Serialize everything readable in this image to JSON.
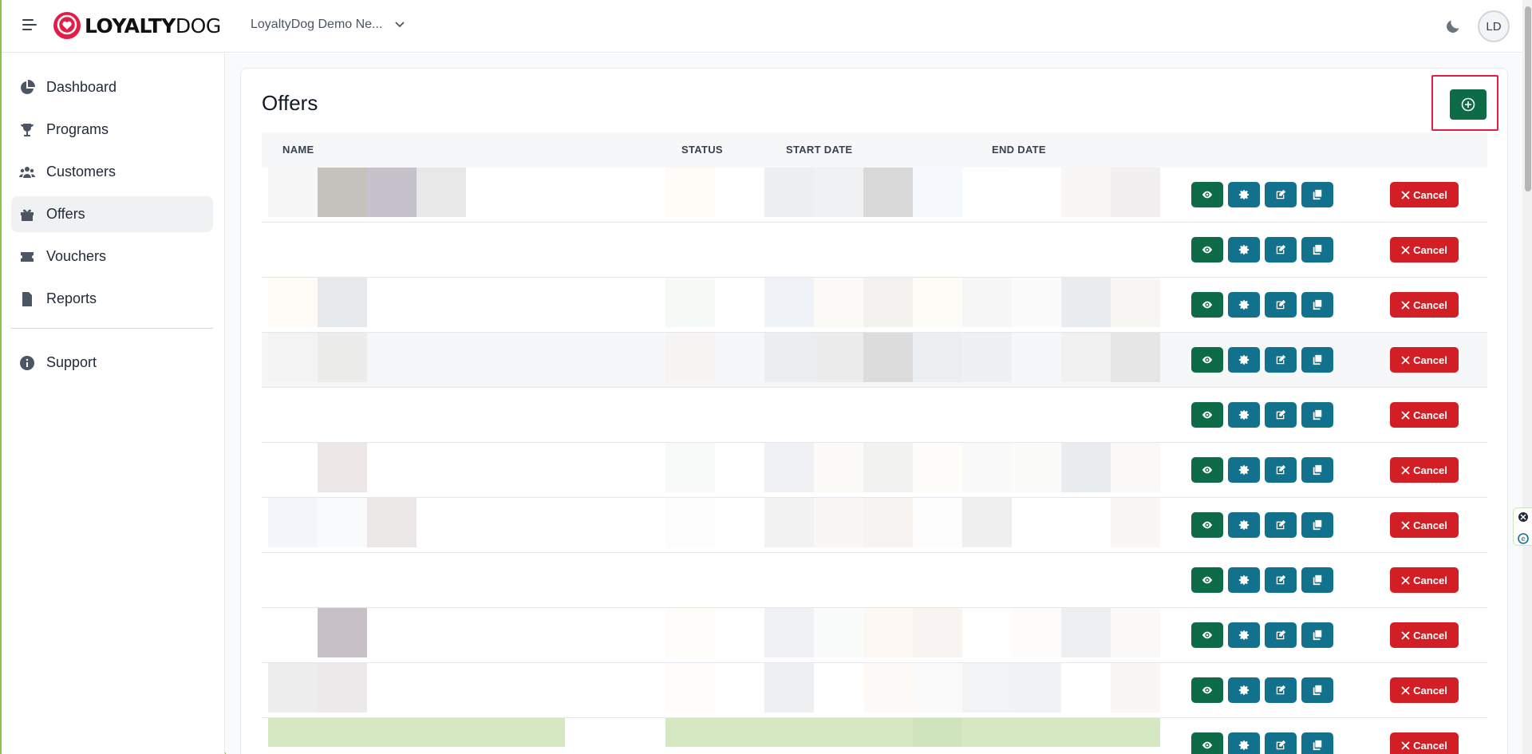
{
  "header": {
    "logo_bold": "LOYALTY",
    "logo_light": "DOG",
    "org_name": "LoyaltyDog Demo Ne...",
    "avatar_initials": "LD"
  },
  "sidebar": {
    "items": [
      {
        "label": "Dashboard",
        "icon": "pie-chart-icon"
      },
      {
        "label": "Programs",
        "icon": "trophy-icon"
      },
      {
        "label": "Customers",
        "icon": "users-icon"
      },
      {
        "label": "Offers",
        "icon": "gift-icon",
        "active": true
      },
      {
        "label": "Vouchers",
        "icon": "ticket-icon"
      },
      {
        "label": "Reports",
        "icon": "report-icon"
      }
    ],
    "support": {
      "label": "Support",
      "icon": "info-icon"
    }
  },
  "main": {
    "title": "Offers",
    "columns": {
      "name": "NAME",
      "status": "STATUS",
      "start_date": "START DATE",
      "end_date": "END DATE"
    },
    "cancel_label": "Cancel",
    "row_count": 11
  },
  "colors": {
    "brand_green": "#0d6b47",
    "action_blue": "#12718c",
    "danger_red": "#d21f26",
    "logo_red": "#e11d48"
  }
}
